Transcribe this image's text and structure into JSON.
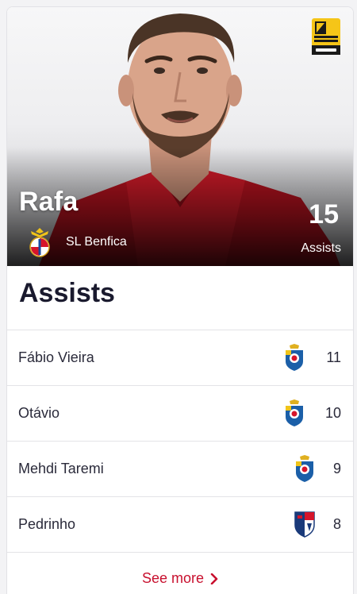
{
  "hero": {
    "player_name": "Rafa",
    "team_name": "SL Benfica",
    "stat_value": "15",
    "stat_label": "Assists",
    "league_logo_text": [
      "LIGA",
      "PORTUGAL",
      "bwin"
    ],
    "team_crest_icon": "benfica-crest-icon"
  },
  "section": {
    "title": "Assists"
  },
  "rows": [
    {
      "name": "Fábio Vieira",
      "value": "11",
      "crest_icon": "fc-porto-crest-icon"
    },
    {
      "name": "Otávio",
      "value": "10",
      "crest_icon": "fc-porto-crest-icon"
    },
    {
      "name": "Mehdi Taremi",
      "value": "9",
      "crest_icon": "fc-porto-crest-icon"
    },
    {
      "name": "Pedrinho",
      "value": "8",
      "crest_icon": "gil-vicente-crest-icon"
    }
  ],
  "footer": {
    "see_more_label": "See more"
  },
  "colors": {
    "accent": "#c8102e",
    "text": "#2a2a3a",
    "title": "#1a1a2e",
    "divider": "#e3e3e7",
    "porto_blue": "#1b5fa8",
    "league_yellow": "#f5c518"
  }
}
